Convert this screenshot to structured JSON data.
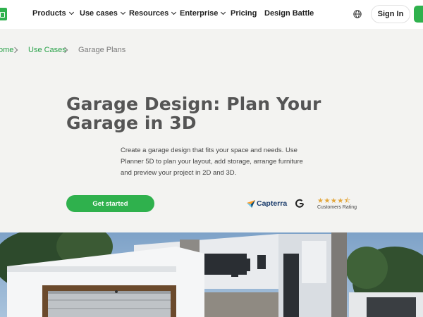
{
  "nav": {
    "items": [
      {
        "label": "Products",
        "dropdown": true
      },
      {
        "label": "Use cases",
        "dropdown": true
      },
      {
        "label": "Resources",
        "dropdown": true
      },
      {
        "label": "Enterprise",
        "dropdown": true
      },
      {
        "label": "Pricing",
        "dropdown": false
      },
      {
        "label": "Design Battle",
        "dropdown": false
      }
    ],
    "signin_label": "Sign In",
    "globe_icon": "globe-icon",
    "logo_icon": "planner5d-logo-icon"
  },
  "breadcrumb": {
    "items": [
      "ome",
      "Use Cases",
      "Garage Plans"
    ]
  },
  "hero": {
    "title": "Garage Design: Plan Your Garage in 3D",
    "description": "Create a garage design that fits your space and needs. Use Planner 5D to plan your layout, add storage, arrange furniture and preview your project in 2D and 3D.",
    "cta_label": "Get started"
  },
  "ratings": {
    "capterra_label": "Capterra",
    "stars_value": 4.5,
    "stars_max": 5,
    "stars_glyphs": "★★★★⯪",
    "customers_label": "Customers Rating"
  },
  "colors": {
    "brand_green": "#2fb14d",
    "link_green": "#2aa24a",
    "title_gray": "#555555",
    "background": "#f3f3f1",
    "star_orange": "#e3a63a",
    "capterra_blue": "#193b6b"
  }
}
